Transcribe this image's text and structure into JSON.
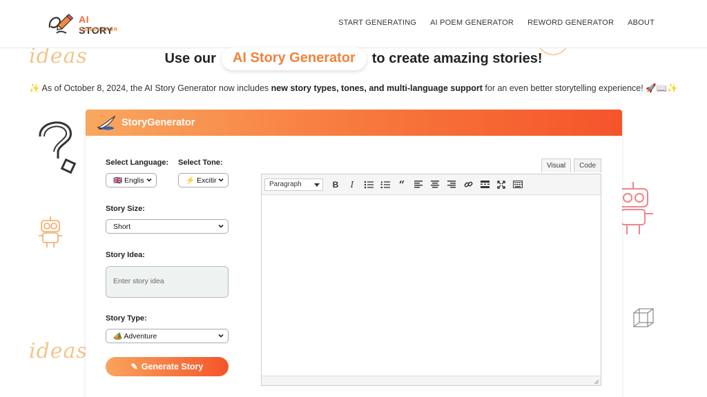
{
  "header": {
    "logo": {
      "title_ai": "AI",
      "title_rest": " STORY",
      "subtitle": "GENERATOR"
    },
    "nav": [
      "START GENERATING",
      "AI POEM GENERATOR",
      "REWORD GENERATOR",
      "ABOUT"
    ]
  },
  "decor": {
    "ideas_text": "ideas"
  },
  "hero": {
    "prefix": "Use our",
    "highlight": "AI Story Generator",
    "suffix": "to create amazing stories!"
  },
  "announcement": {
    "lead_emoji": "✨",
    "before": " As of October 8, 2024, the AI Story Generator now includes ",
    "bold": "new story types, tones, and multi-language support",
    "after": " for an even better storytelling experience! ",
    "trail_emoji": "🚀📖✨"
  },
  "card": {
    "title": "StoryGenerator",
    "language": {
      "label": "Select Language:",
      "value": "🇬🇧 Englis"
    },
    "tone": {
      "label": "Select Tone:",
      "value": "⚡ Excitir"
    },
    "size": {
      "label": "Story Size:",
      "value": "Short"
    },
    "idea": {
      "label": "Story Idea:",
      "placeholder": "Enter story idea"
    },
    "type": {
      "label": "Story Type:",
      "value": "🏕️ Adventure"
    },
    "generate_label": "Generate Story"
  },
  "editor": {
    "tabs": [
      "Visual",
      "Code"
    ],
    "format_value": "Paragraph",
    "toolbar_icons": [
      "bold-icon",
      "italic-icon",
      "bullet-list-icon",
      "numbered-list-icon",
      "blockquote-icon",
      "align-left-icon",
      "align-center-icon",
      "align-right-icon",
      "link-icon",
      "read-more-icon",
      "fullscreen-icon",
      "keyboard-icon"
    ],
    "bold_glyph": "B",
    "italic_glyph": "I"
  },
  "colors": {
    "accent": "#f2823c",
    "gradient_start": "#f9a760",
    "gradient_end": "#f5542a"
  }
}
